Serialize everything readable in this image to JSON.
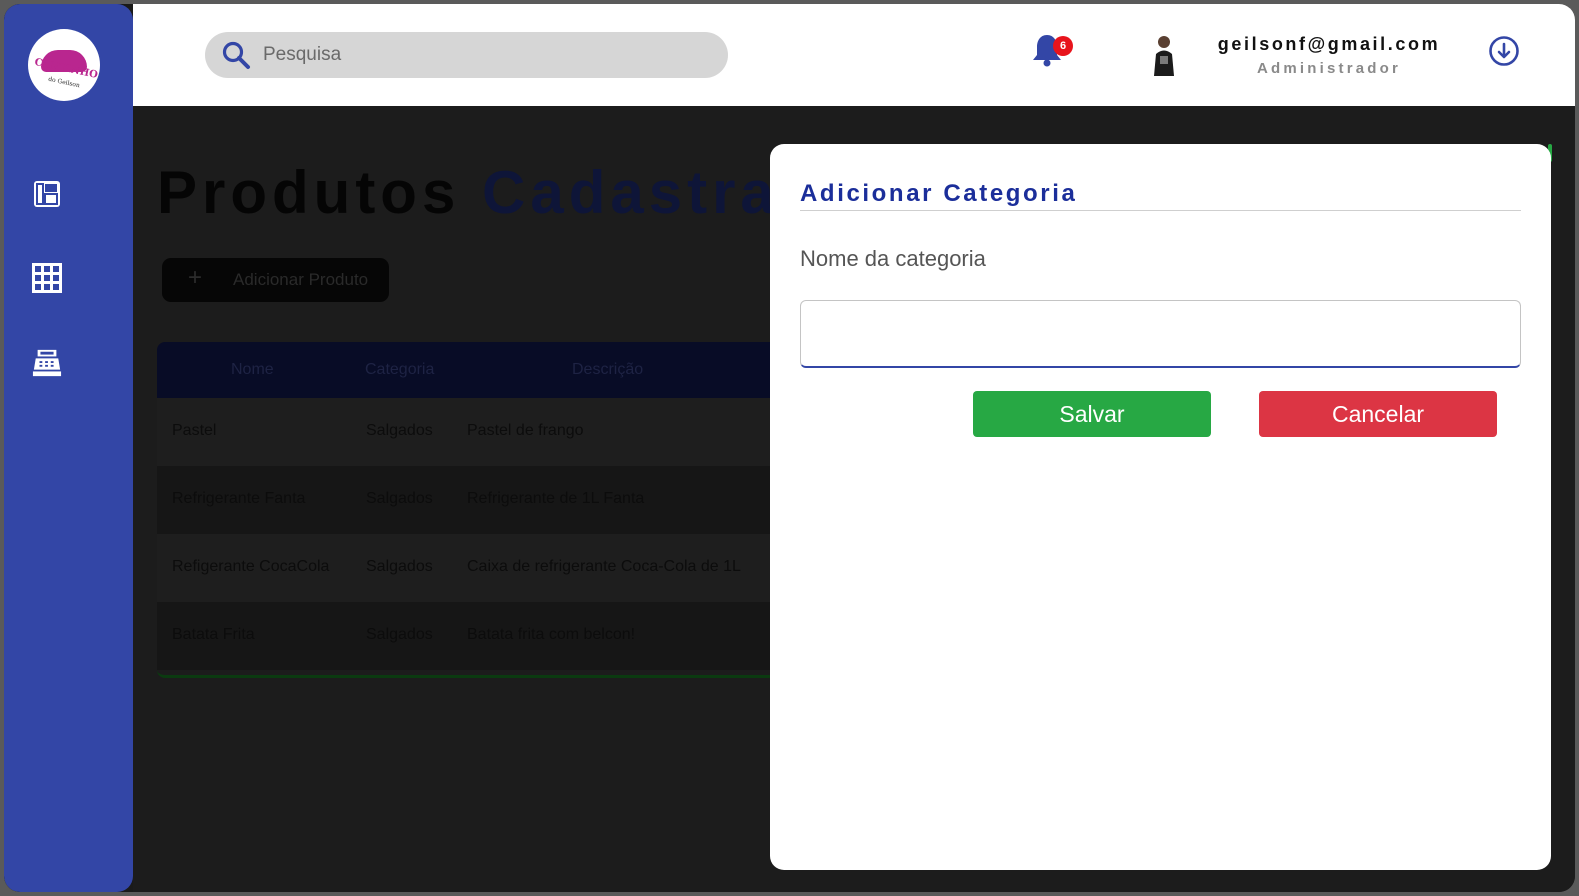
{
  "app": {
    "logo_text": "CANTINHO",
    "logo_subtext": "do Geilson"
  },
  "sidebar": {
    "items": [
      {
        "icon": "dashboard-icon"
      },
      {
        "icon": "grid-icon"
      },
      {
        "icon": "cash-register-icon"
      }
    ]
  },
  "topbar": {
    "search_placeholder": "Pesquisa",
    "notification_count": "6",
    "user_email": "geilsonf@gmail.com",
    "user_role": "Administrador"
  },
  "main": {
    "title_part1": "Produtos",
    "title_part2": "Cadastrad",
    "add_product_label": "Adicionar Produto",
    "table": {
      "headers": [
        "Nome",
        "Categoria",
        "Descrição"
      ],
      "rows": [
        [
          "Pastel",
          "Salgados",
          "Pastel de frango"
        ],
        [
          "Refrigerante Fanta",
          "Salgados",
          "Refrigerante de 1L Fanta"
        ],
        [
          "Refigerante CocaCola",
          "Salgados",
          "Caixa de refrigerante Coca-Cola de 1L"
        ],
        [
          "Batata Frita",
          "Salgados",
          "Batata frita com belcon!"
        ]
      ]
    }
  },
  "modal": {
    "title": "Adicionar Categoria",
    "field_label": "Nome da categoria",
    "field_value": "",
    "save_label": "Salvar",
    "cancel_label": "Cancelar"
  },
  "colors": {
    "primary": "#3346a6",
    "save": "#27a844",
    "cancel": "#dc3544",
    "badge": "#e8141c"
  }
}
